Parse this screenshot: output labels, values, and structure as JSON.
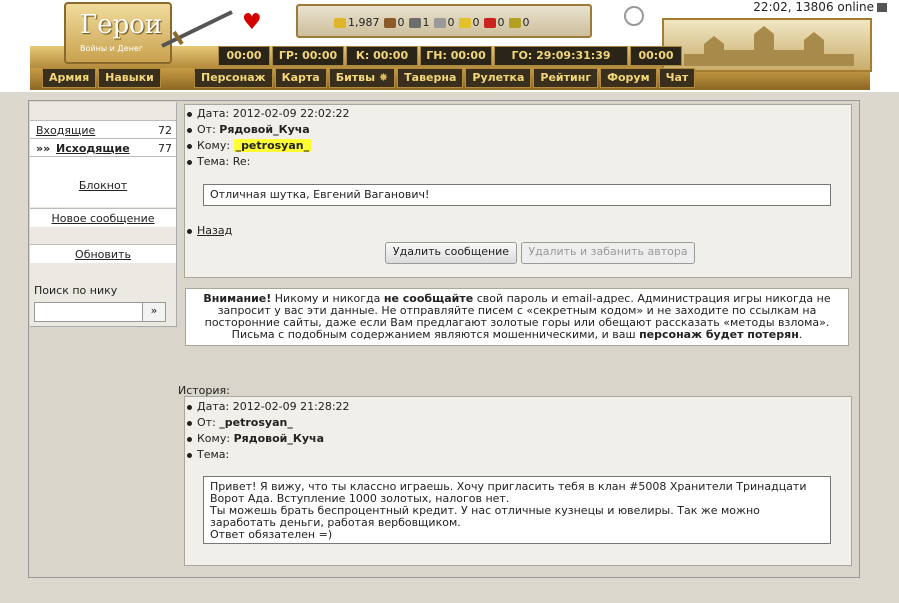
{
  "header": {
    "logo_title": "Герои",
    "logo_subtitle": "Войны и Денег",
    "clock": "22:02, 13806 online",
    "resources": [
      {
        "icon": "gold-icon",
        "value": "1,987",
        "color": "#e0b52a"
      },
      {
        "icon": "wood-icon",
        "value": "0",
        "color": "#8b5a2b"
      },
      {
        "icon": "ore-icon",
        "value": "1",
        "color": "#6d6d6d"
      },
      {
        "icon": "mercury-icon",
        "value": "0",
        "color": "#999999"
      },
      {
        "icon": "sulfur-icon",
        "value": "0",
        "color": "#e3c12a"
      },
      {
        "icon": "crystal-icon",
        "value": "0",
        "color": "#cc2222"
      },
      {
        "icon": "gems-icon",
        "value": "0",
        "color": "#b3a020"
      }
    ],
    "timers": [
      "00:00",
      "ГР: 00:00",
      "К: 00:00",
      "ГН: 00:00",
      "ГО: 29:09:31:39",
      "00:00"
    ],
    "left_menu": [
      "Армия",
      "Навыки"
    ],
    "nav": [
      "Персонаж",
      "Карта",
      "Битвы",
      "Таверна",
      "Рулетка",
      "Рейтинг",
      "Форум",
      "Чат"
    ]
  },
  "sidebar": {
    "inbox_label": "Входящие",
    "inbox_count": "72",
    "outbox_label": "Исходящие",
    "outbox_prefix": "»»",
    "outbox_count": "77",
    "notepad_label": "Блокнот",
    "new_message_label": "Новое сообщение",
    "refresh_label": "Обновить",
    "search_label": "Поиск по нику",
    "search_button": "»"
  },
  "message": {
    "date_label": "Дата:",
    "date": "2012-02-09 22:02:22",
    "from_label": "От:",
    "from": "Рядовой_Куча",
    "to_label": "Кому:",
    "to": "_petrosyan_",
    "subject_label": "Тема:",
    "subject": "Re:",
    "body": "Отличная шутка, Евгений Ваганович!",
    "back_label": "Назад",
    "delete_button": "Удалить сообщение",
    "delete_ban_button": "Удалить и забанить автора"
  },
  "warning": {
    "title": "Внимание!",
    "text1": " Никому и никогда ",
    "bold1": "не сообщайте",
    "text2": " свой пароль и email-адрес. Администрация игры никогда не запросит у вас эти данные. Не отправляйте писем с «секретным кодом» и не заходите по ссылкам на посторонние сайты, даже если Вам предлагают золотые горы или обещают рассказать «методы взлома». Письма с подобным содержанием являются мошенническими, и ваш ",
    "bold2": "персонаж будет потерян",
    "text3": "."
  },
  "history": {
    "label": "История:",
    "date_label": "Дата:",
    "date": "2012-02-09 21:28:22",
    "from_label": "От:",
    "from": "_petrosyan_",
    "to_label": "Кому:",
    "to": "Рядовой_Куча",
    "subject_label": "Тема:",
    "body": "Привет! Я вижу, что ты классно играешь. Хочу пригласить тебя в клан #5008 Хранители Тринадцати Ворот Ада. Вступление 1000 золотых, налогов нет.\nТы можешь брать беспроцентный кредит. У нас отличные кузнецы и ювелиры. Так же можно заработать деньги, работая вербовщиком.\nОтвет обязателен =)"
  }
}
